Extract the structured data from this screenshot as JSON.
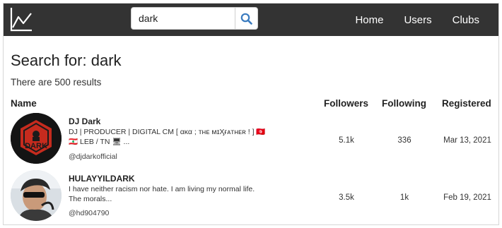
{
  "header": {
    "logo": "line-chart-logo",
    "search": {
      "value": "dark",
      "icon": "search-icon"
    },
    "nav": [
      "Home",
      "Users",
      "Clubs"
    ],
    "bg_color": "#333333",
    "accent_color": "#3a7bbf"
  },
  "main": {
    "title": "Search for: dark",
    "result_count": "There are 500 results",
    "columns": {
      "name": "Name",
      "followers": "Followers",
      "following": "Following",
      "registered": "Registered"
    },
    "rows": [
      {
        "name": "DJ Dark",
        "bio": "DJ | PRODUCER | DIGITAL CM [ ακα ; ᴛʜᴇ ᴍɪӼғᴀᴛʜᴇʀ ! ] 🇹🇳 🇱🇧 LEB / TN 🖥 ...",
        "handle": "@djdarkofficial",
        "avatar_text": "DARK",
        "followers": "5.1k",
        "following": "336",
        "registered": "Mar 13, 2021"
      },
      {
        "name": "HULAYYILDARK",
        "bio": "I have neither racism nor hate. I am living my normal life. The morals...",
        "handle": "@hd904790",
        "followers": "3.5k",
        "following": "1k",
        "registered": "Feb 19, 2021"
      }
    ]
  }
}
